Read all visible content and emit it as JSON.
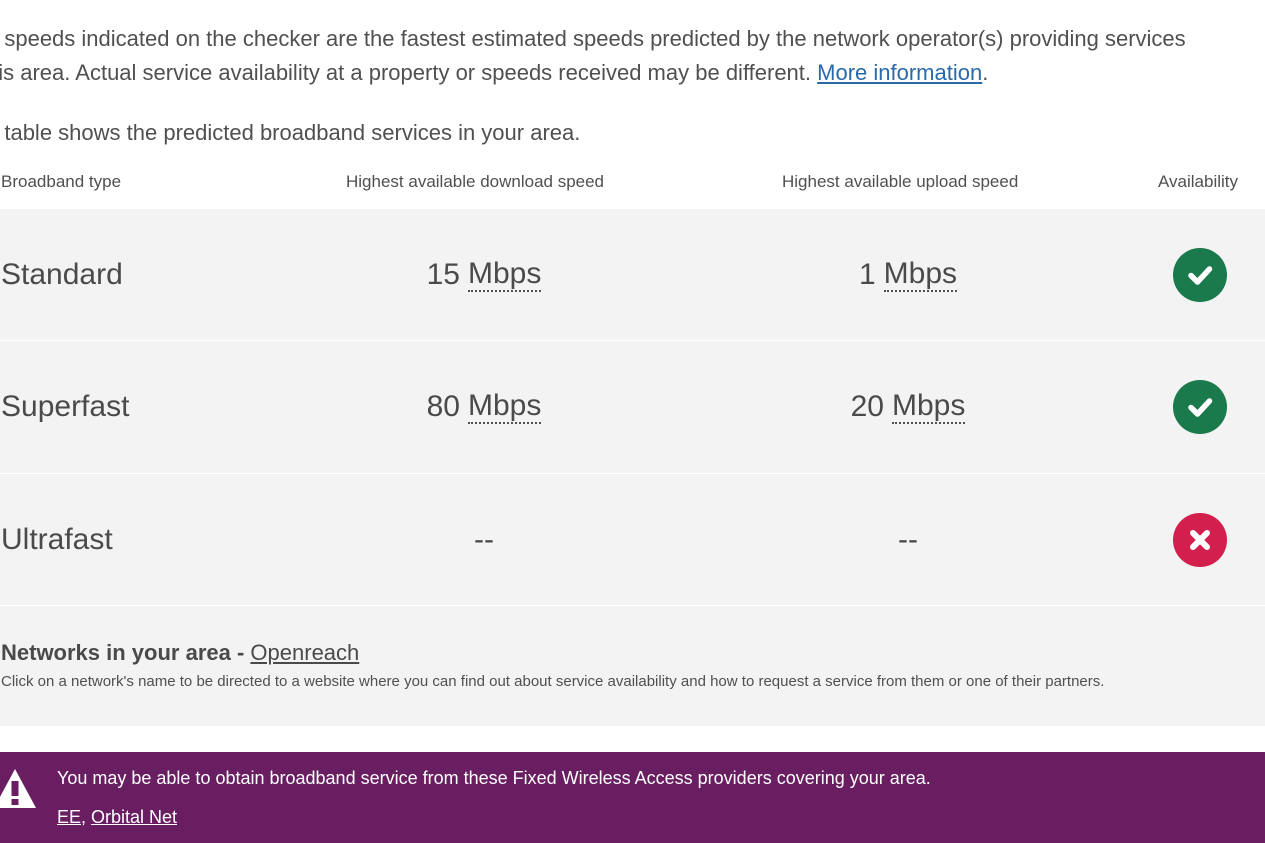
{
  "intro": {
    "line1": "e speeds indicated on the checker are the fastest estimated speeds predicted by the network operator(s) providing services",
    "line2_prefix": "his area. Actual service availability at a property or speeds received may be different. ",
    "more_info_link": "More information",
    "line2_suffix": "."
  },
  "table_intro": "e table shows the predicted broadband services in your area.",
  "table": {
    "headers": {
      "type": "Broadband type",
      "download": "Highest available download speed",
      "upload": "Highest available upload speed",
      "availability": "Availability"
    },
    "rows": [
      {
        "type": "Standard",
        "download_value": "15",
        "download_unit": "Mbps",
        "upload_value": "1",
        "upload_unit": "Mbps",
        "available": true,
        "status_icon": "check-circle-icon",
        "color": "#1a7a4c"
      },
      {
        "type": "Superfast",
        "download_value": "80",
        "download_unit": "Mbps",
        "upload_value": "20",
        "upload_unit": "Mbps",
        "available": true,
        "status_icon": "check-circle-icon",
        "color": "#1a7a4c"
      },
      {
        "type": "Ultrafast",
        "download_value": "--",
        "download_unit": "",
        "upload_value": "--",
        "upload_unit": "",
        "available": false,
        "status_icon": "cross-circle-icon",
        "color": "#d31f4e"
      }
    ]
  },
  "networks": {
    "title": "Networks in your area - ",
    "provider_link": "Openreach",
    "note": "Click on a network's name to be directed to a website where you can find out about service availability and how to request a service from them or one of their partners."
  },
  "fwa": {
    "message": "You may be able to obtain broadband service from these Fixed Wireless Access providers covering your area.",
    "links": [
      "EE",
      "Orbital Net"
    ],
    "separator": ", ",
    "background": "#6a1e62",
    "icon": "warning-icon"
  }
}
